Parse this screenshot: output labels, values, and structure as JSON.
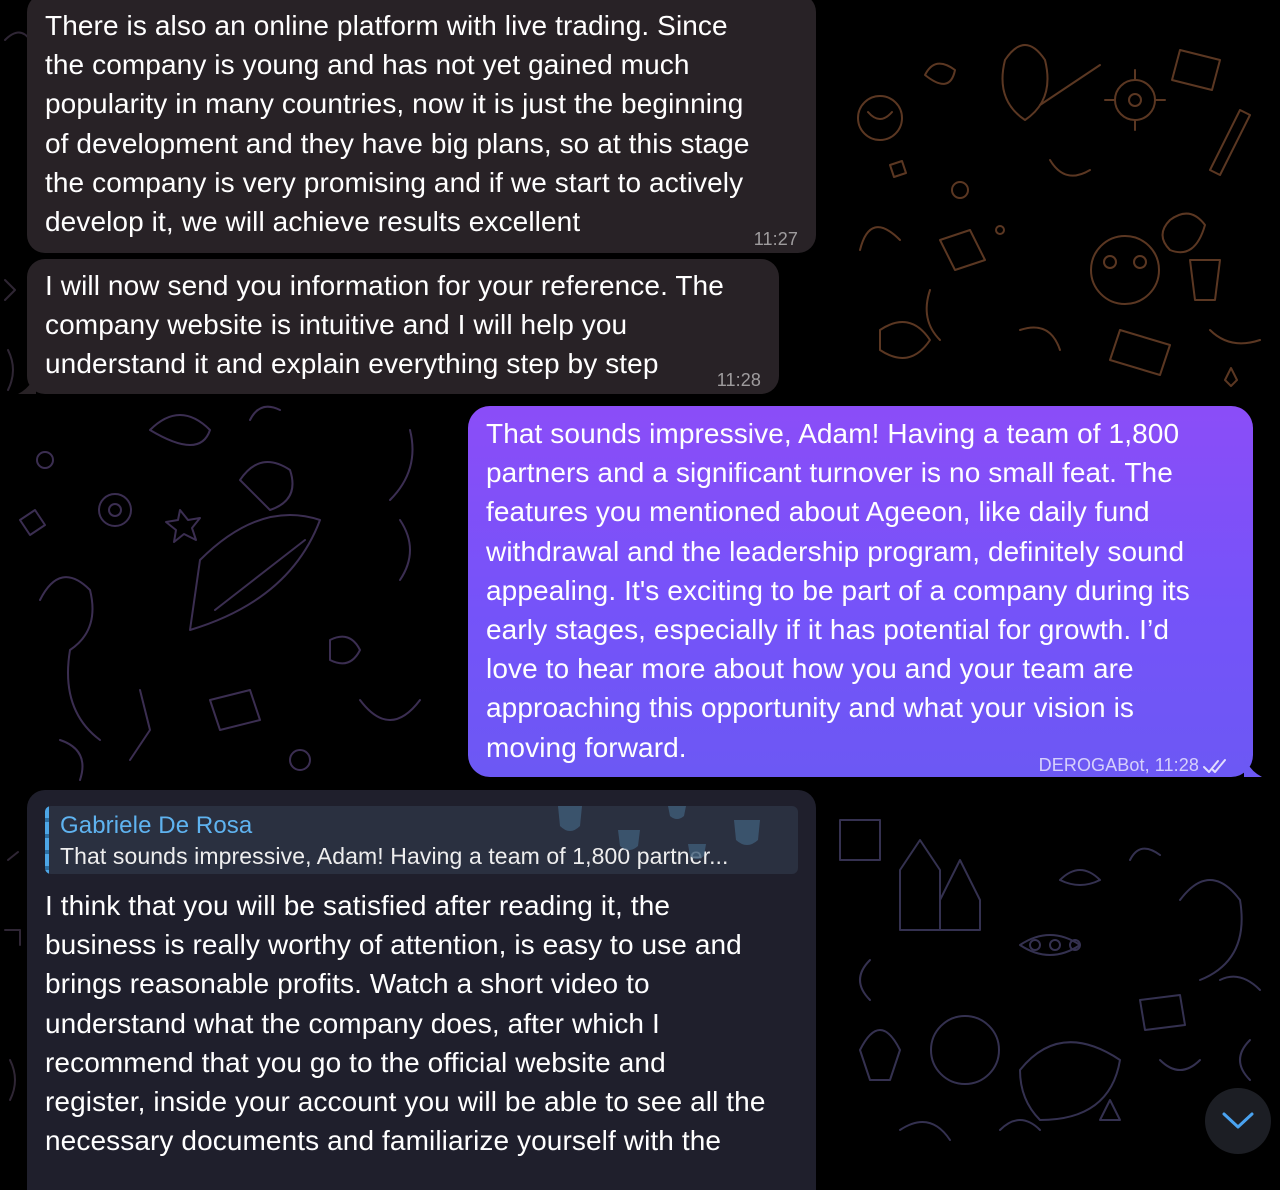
{
  "messages": [
    {
      "id": "m1",
      "direction": "incoming",
      "text": "There is also an online platform with live trading. Since\nthe company is young and has not yet gained much\npopularity in many countries, now it is just the beginning\nof development and they have big plans, so at this stage\nthe company is very promising and if we start to actively\ndevelop it, we will achieve results excellent",
      "time": "11:27"
    },
    {
      "id": "m2",
      "direction": "incoming",
      "text": "I will now send you information for your reference. The\ncompany website is intuitive and I will help you\nunderstand it and explain everything step by step",
      "time": "11:28"
    },
    {
      "id": "m3",
      "direction": "outgoing",
      "text": "That sounds impressive, Adam! Having a team of 1,800\npartners and a significant turnover is no small feat. The\nfeatures you mentioned about Ageeon, like daily fund\nwithdrawal and the leadership program, definitely sound\nappealing. It's exciting to be part of a company during its\nearly stages, especially if it has potential for growth. I’d\nlove to hear more about how you and your team are\napproaching this opportunity and what your vision is\nmoving forward.",
      "signature": "DEROGABot, 11:28",
      "status_icon": "double-check-icon"
    },
    {
      "id": "m4",
      "direction": "incoming",
      "reply": {
        "author": "Gabriele De Rosa",
        "preview": "That sounds impressive, Adam! Having a team of 1,800 partner..."
      },
      "text": "I think that you will be satisfied after reading it, the\nbusiness is really worthy of attention, is easy to use and\nbrings reasonable profits. Watch a short video to\nunderstand what the company does, after which I\nrecommend that you go to the official website and\nregister, inside your account you will be able to see all the\nnecessary documents and familiarize yourself with the"
    }
  ],
  "controls": {
    "scroll_down_icon": "chevron-down-icon"
  },
  "colors": {
    "incoming_bubble": "#282226",
    "reply_bubble": "#1f1f2c",
    "outgoing_top": "#8b4df8",
    "outgoing_bottom": "#6c58f4",
    "reply_accent": "#5fb3f0",
    "scroll_button": "#1c1e24"
  }
}
